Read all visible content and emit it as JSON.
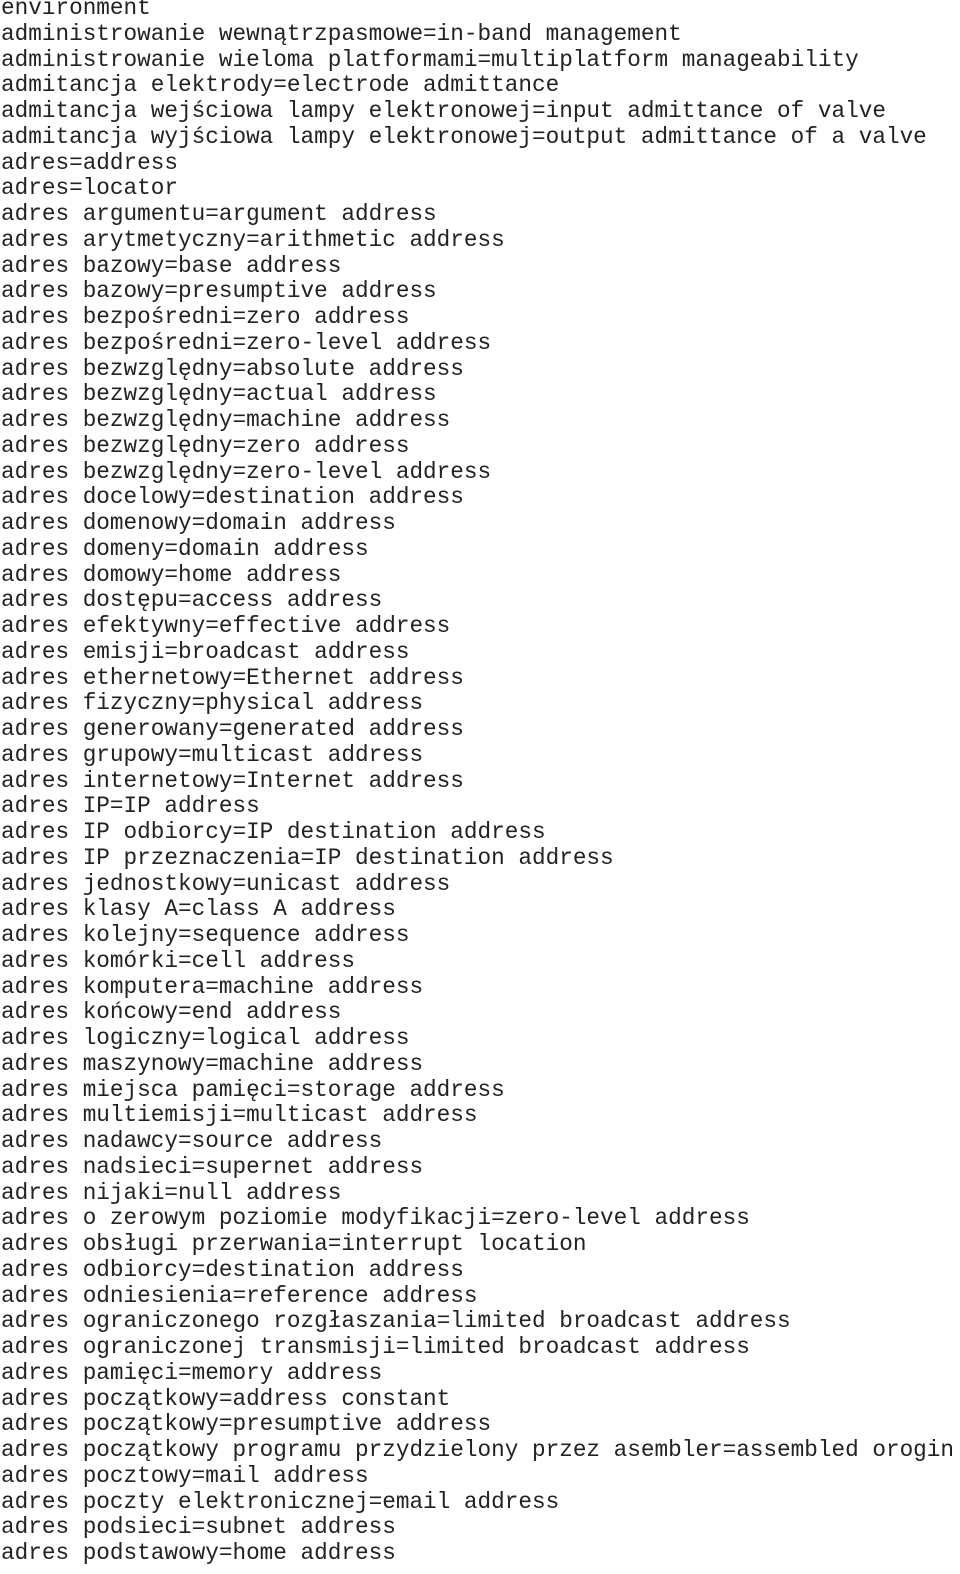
{
  "document": {
    "kind": "plain-text-glossary",
    "language_pair": "Polish-English",
    "background_color": "#ffffff",
    "text_color": "#222222",
    "first_line_is_continuation": true,
    "line_count": 61,
    "lines": [
      "environment",
      "administrowanie wewnątrzpasmowe=in-band management",
      "administrowanie wieloma platformami=multiplatform manageability",
      "admitancja elektrody=electrode admittance",
      "admitancja wejściowa lampy elektronowej=input admittance of valve",
      "admitancja wyjściowa lampy elektronowej=output admittance of a valve",
      "adres=address",
      "adres=locator",
      "adres argumentu=argument address",
      "adres arytmetyczny=arithmetic address",
      "adres bazowy=base address",
      "adres bazowy=presumptive address",
      "adres bezpośredni=zero address",
      "adres bezpośredni=zero-level address",
      "adres bezwzględny=absolute address",
      "adres bezwzględny=actual address",
      "adres bezwzględny=machine address",
      "adres bezwzględny=zero address",
      "adres bezwzględny=zero-level address",
      "adres docelowy=destination address",
      "adres domenowy=domain address",
      "adres domeny=domain address",
      "adres domowy=home address",
      "adres dostępu=access address",
      "adres efektywny=effective address",
      "adres emisji=broadcast address",
      "adres ethernetowy=Ethernet address",
      "adres fizyczny=physical address",
      "adres generowany=generated address",
      "adres grupowy=multicast address",
      "adres internetowy=Internet address",
      "adres IP=IP address",
      "adres IP odbiorcy=IP destination address",
      "adres IP przeznaczenia=IP destination address",
      "adres jednostkowy=unicast address",
      "adres klasy A=class A address",
      "adres kolejny=sequence address",
      "adres komórki=cell address",
      "adres komputera=machine address",
      "adres końcowy=end address",
      "adres logiczny=logical address",
      "adres maszynowy=machine address",
      "adres miejsca pamięci=storage address",
      "adres multiemisji=multicast address",
      "adres nadawcy=source address",
      "adres nadsieci=supernet address",
      "adres nijaki=null address",
      "adres o zerowym poziomie modyfikacji=zero-level address",
      "adres obsługi przerwania=interrupt location",
      "adres odbiorcy=destination address",
      "adres odniesienia=reference address",
      "adres ograniczonego rozgłaszania=limited broadcast address",
      "adres ograniczonej transmisji=limited broadcast address",
      "adres pamięci=memory address",
      "adres początkowy=address constant",
      "adres początkowy=presumptive address",
      "adres początkowy programu przydzielony przez asembler=assembled orogin",
      "adres pocztowy=mail address",
      "adres poczty elektronicznej=email address",
      "adres podsieci=subnet address",
      "adres podstawowy=home address"
    ]
  }
}
